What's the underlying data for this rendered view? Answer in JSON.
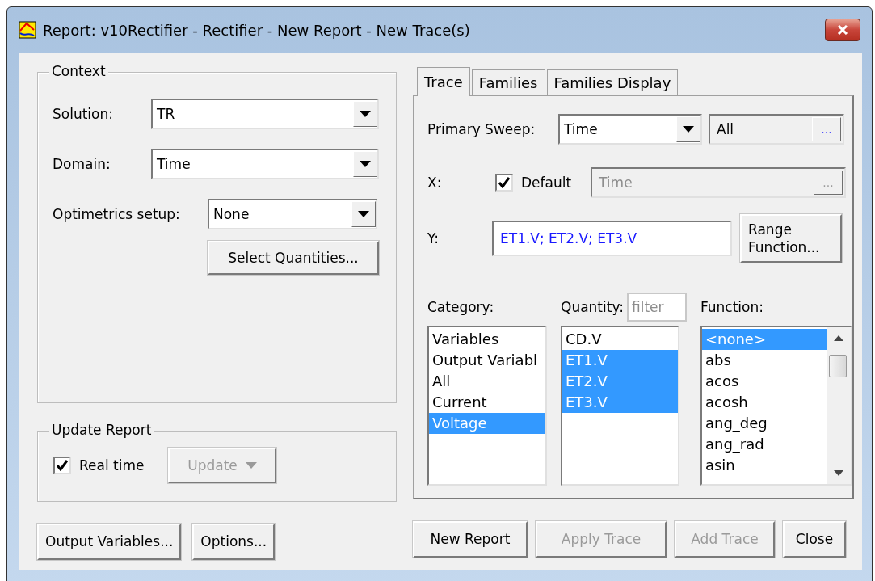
{
  "window": {
    "title": "Report: v10Rectifier - Rectifier - New Report - New Trace(s)"
  },
  "context": {
    "legend": "Context",
    "fields": [
      {
        "label": "Solution:",
        "value": "TR"
      },
      {
        "label": "Domain:",
        "value": "Time"
      },
      {
        "label": "Optimetrics setup:",
        "value": "None"
      }
    ],
    "select_button": "Select Quantities..."
  },
  "update_report": {
    "legend": "Update Report",
    "real_time": {
      "label": "Real time",
      "checked": true
    },
    "update_button": {
      "label": "Update",
      "disabled": true
    }
  },
  "tabs": [
    {
      "label": "Trace",
      "selected": true
    },
    {
      "label": "Families",
      "selected": false
    },
    {
      "label": "Families Display",
      "selected": false
    }
  ],
  "trace": {
    "primary_sweep": {
      "label": "Primary Sweep:",
      "value": "Time",
      "range": "All",
      "range_button": "..."
    },
    "x": {
      "label": "X:",
      "default_label": "Default",
      "default_checked": true,
      "value": "Time",
      "disabled": true,
      "button": "..."
    },
    "y": {
      "label": "Y:",
      "value": "ET1.V; ET2.V; ET3.V"
    },
    "range_function_button": "Range Function...",
    "category": {
      "label": "Category:",
      "items": [
        {
          "label": "Variables",
          "selected": false
        },
        {
          "label": "Output Variabl",
          "selected": false
        },
        {
          "label": "All",
          "selected": false
        },
        {
          "label": "Current",
          "selected": false
        },
        {
          "label": "Voltage",
          "selected": true
        }
      ]
    },
    "quantity": {
      "label": "Quantity:",
      "filter_placeholder": "filter",
      "items": [
        {
          "label": "CD.V",
          "selected": false
        },
        {
          "label": "ET1.V",
          "selected": true
        },
        {
          "label": "ET2.V",
          "selected": true
        },
        {
          "label": "ET3.V",
          "selected": true
        }
      ]
    },
    "function": {
      "label": "Function:",
      "items": [
        {
          "label": "<none>",
          "selected": true
        },
        {
          "label": "abs",
          "selected": false
        },
        {
          "label": "acos",
          "selected": false
        },
        {
          "label": "acosh",
          "selected": false
        },
        {
          "label": "ang_deg",
          "selected": false
        },
        {
          "label": "ang_rad",
          "selected": false
        },
        {
          "label": "asin",
          "selected": false
        }
      ]
    }
  },
  "left_buttons": [
    {
      "label": "Output Variables...",
      "disabled": false
    },
    {
      "label": "Options...",
      "disabled": false
    }
  ],
  "right_buttons": [
    {
      "label": "New Report",
      "disabled": false
    },
    {
      "label": "Apply Trace",
      "disabled": true
    },
    {
      "label": "Add Trace",
      "disabled": true
    },
    {
      "label": "Close",
      "disabled": false
    }
  ]
}
